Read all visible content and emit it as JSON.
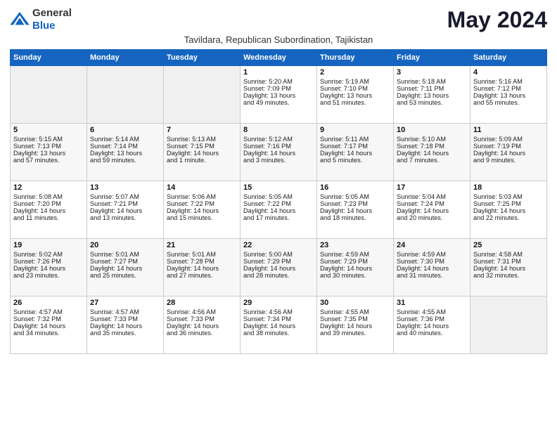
{
  "header": {
    "logo_general": "General",
    "logo_blue": "Blue",
    "month_title": "May 2024",
    "subtitle": "Tavildara, Republican Subordination, Tajikistan"
  },
  "days_of_week": [
    "Sunday",
    "Monday",
    "Tuesday",
    "Wednesday",
    "Thursday",
    "Friday",
    "Saturday"
  ],
  "weeks": [
    [
      {
        "day": "",
        "content": ""
      },
      {
        "day": "",
        "content": ""
      },
      {
        "day": "",
        "content": ""
      },
      {
        "day": "1",
        "content": "Sunrise: 5:20 AM\nSunset: 7:09 PM\nDaylight: 13 hours\nand 49 minutes."
      },
      {
        "day": "2",
        "content": "Sunrise: 5:19 AM\nSunset: 7:10 PM\nDaylight: 13 hours\nand 51 minutes."
      },
      {
        "day": "3",
        "content": "Sunrise: 5:18 AM\nSunset: 7:11 PM\nDaylight: 13 hours\nand 53 minutes."
      },
      {
        "day": "4",
        "content": "Sunrise: 5:16 AM\nSunset: 7:12 PM\nDaylight: 13 hours\nand 55 minutes."
      }
    ],
    [
      {
        "day": "5",
        "content": "Sunrise: 5:15 AM\nSunset: 7:13 PM\nDaylight: 13 hours\nand 57 minutes."
      },
      {
        "day": "6",
        "content": "Sunrise: 5:14 AM\nSunset: 7:14 PM\nDaylight: 13 hours\nand 59 minutes."
      },
      {
        "day": "7",
        "content": "Sunrise: 5:13 AM\nSunset: 7:15 PM\nDaylight: 14 hours\nand 1 minute."
      },
      {
        "day": "8",
        "content": "Sunrise: 5:12 AM\nSunset: 7:16 PM\nDaylight: 14 hours\nand 3 minutes."
      },
      {
        "day": "9",
        "content": "Sunrise: 5:11 AM\nSunset: 7:17 PM\nDaylight: 14 hours\nand 5 minutes."
      },
      {
        "day": "10",
        "content": "Sunrise: 5:10 AM\nSunset: 7:18 PM\nDaylight: 14 hours\nand 7 minutes."
      },
      {
        "day": "11",
        "content": "Sunrise: 5:09 AM\nSunset: 7:19 PM\nDaylight: 14 hours\nand 9 minutes."
      }
    ],
    [
      {
        "day": "12",
        "content": "Sunrise: 5:08 AM\nSunset: 7:20 PM\nDaylight: 14 hours\nand 11 minutes."
      },
      {
        "day": "13",
        "content": "Sunrise: 5:07 AM\nSunset: 7:21 PM\nDaylight: 14 hours\nand 13 minutes."
      },
      {
        "day": "14",
        "content": "Sunrise: 5:06 AM\nSunset: 7:22 PM\nDaylight: 14 hours\nand 15 minutes."
      },
      {
        "day": "15",
        "content": "Sunrise: 5:05 AM\nSunset: 7:22 PM\nDaylight: 14 hours\nand 17 minutes."
      },
      {
        "day": "16",
        "content": "Sunrise: 5:05 AM\nSunset: 7:23 PM\nDaylight: 14 hours\nand 18 minutes."
      },
      {
        "day": "17",
        "content": "Sunrise: 5:04 AM\nSunset: 7:24 PM\nDaylight: 14 hours\nand 20 minutes."
      },
      {
        "day": "18",
        "content": "Sunrise: 5:03 AM\nSunset: 7:25 PM\nDaylight: 14 hours\nand 22 minutes."
      }
    ],
    [
      {
        "day": "19",
        "content": "Sunrise: 5:02 AM\nSunset: 7:26 PM\nDaylight: 14 hours\nand 23 minutes."
      },
      {
        "day": "20",
        "content": "Sunrise: 5:01 AM\nSunset: 7:27 PM\nDaylight: 14 hours\nand 25 minutes."
      },
      {
        "day": "21",
        "content": "Sunrise: 5:01 AM\nSunset: 7:28 PM\nDaylight: 14 hours\nand 27 minutes."
      },
      {
        "day": "22",
        "content": "Sunrise: 5:00 AM\nSunset: 7:29 PM\nDaylight: 14 hours\nand 28 minutes."
      },
      {
        "day": "23",
        "content": "Sunrise: 4:59 AM\nSunset: 7:29 PM\nDaylight: 14 hours\nand 30 minutes."
      },
      {
        "day": "24",
        "content": "Sunrise: 4:59 AM\nSunset: 7:30 PM\nDaylight: 14 hours\nand 31 minutes."
      },
      {
        "day": "25",
        "content": "Sunrise: 4:58 AM\nSunset: 7:31 PM\nDaylight: 14 hours\nand 32 minutes."
      }
    ],
    [
      {
        "day": "26",
        "content": "Sunrise: 4:57 AM\nSunset: 7:32 PM\nDaylight: 14 hours\nand 34 minutes."
      },
      {
        "day": "27",
        "content": "Sunrise: 4:57 AM\nSunset: 7:33 PM\nDaylight: 14 hours\nand 35 minutes."
      },
      {
        "day": "28",
        "content": "Sunrise: 4:56 AM\nSunset: 7:33 PM\nDaylight: 14 hours\nand 36 minutes."
      },
      {
        "day": "29",
        "content": "Sunrise: 4:56 AM\nSunset: 7:34 PM\nDaylight: 14 hours\nand 38 minutes."
      },
      {
        "day": "30",
        "content": "Sunrise: 4:55 AM\nSunset: 7:35 PM\nDaylight: 14 hours\nand 39 minutes."
      },
      {
        "day": "31",
        "content": "Sunrise: 4:55 AM\nSunset: 7:36 PM\nDaylight: 14 hours\nand 40 minutes."
      },
      {
        "day": "",
        "content": ""
      }
    ]
  ]
}
